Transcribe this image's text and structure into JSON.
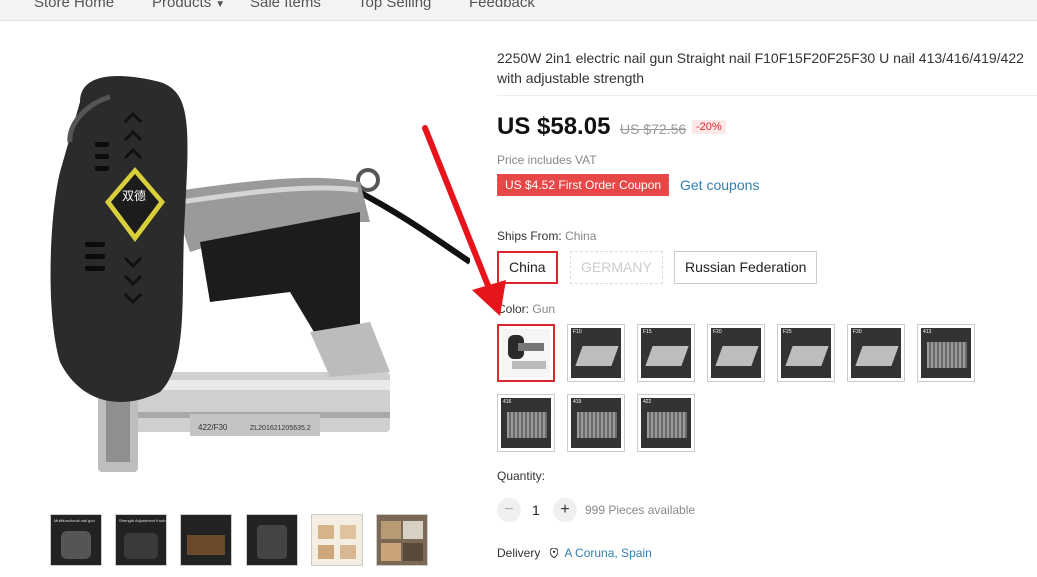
{
  "nav": {
    "items": [
      {
        "label": "Store Home"
      },
      {
        "label": "Products"
      },
      {
        "label": "Sale Items"
      },
      {
        "label": "Top Selling"
      },
      {
        "label": "Feedback"
      }
    ]
  },
  "product": {
    "title": "2250W 2in1 electric nail gun Straight nail F10F15F20F25F30 U nail 413/416/419/422 with adjustable strength",
    "price": "US $58.05",
    "old_price": "US $72.56",
    "discount": "-20%",
    "vat_note": "Price includes VAT",
    "coupon": "US $4.52 First Order Coupon",
    "get_coupons": "Get coupons",
    "image_brand_text": "双德",
    "image_label_text": "422/F30",
    "image_serial_text": "ZL201621205635.2"
  },
  "ships_from": {
    "label": "Ships From:",
    "selected": "China",
    "options": [
      "China",
      "GERMANY",
      "Russian Federation"
    ]
  },
  "color": {
    "label": "Color:",
    "selected": "Gun",
    "swatches": [
      {
        "icon": "nail-gun-thumb"
      },
      {
        "icon": "nails-thumb",
        "tag": "F10"
      },
      {
        "icon": "nails-thumb",
        "tag": "F15"
      },
      {
        "icon": "nails-thumb",
        "tag": "F20"
      },
      {
        "icon": "nails-thumb",
        "tag": "F25"
      },
      {
        "icon": "nails-thumb",
        "tag": "F30"
      },
      {
        "icon": "staples-thumb",
        "tag": "413"
      },
      {
        "icon": "staples-thumb",
        "tag": "416"
      },
      {
        "icon": "staples-thumb",
        "tag": "419"
      },
      {
        "icon": "staples-thumb",
        "tag": "422"
      }
    ]
  },
  "quantity": {
    "label": "Quantity:",
    "value": "1",
    "minus": "−",
    "plus": "+",
    "available": "999 Pieces available"
  },
  "delivery": {
    "label": "Delivery",
    "location": "A Coruna, Spain"
  },
  "thumbnails": [
    {
      "caption": "Multifunctional nail gun"
    },
    {
      "caption": "Strength Adjustment Knob"
    },
    {
      "caption": ""
    },
    {
      "caption": ""
    },
    {
      "caption": ""
    },
    {
      "caption": ""
    }
  ],
  "colors": {
    "accent_red": "#e0262a",
    "coupon_red": "#e84747",
    "link_blue": "#2f7fb0",
    "annotation_arrow": "#e8141b"
  }
}
